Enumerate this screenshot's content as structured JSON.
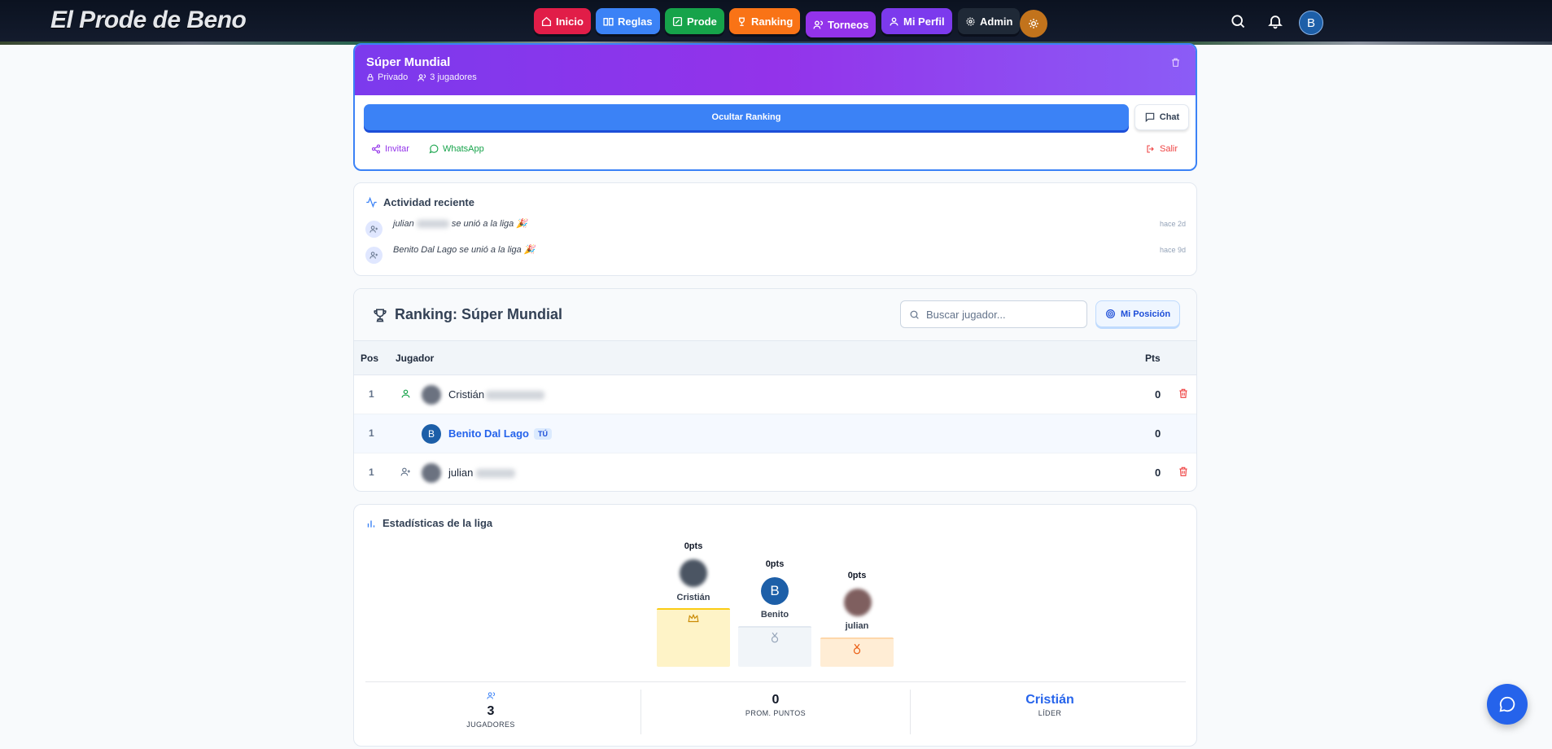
{
  "brand": "El Prode de Beno",
  "nav": [
    {
      "label": "Inicio",
      "icon": "home-icon",
      "color": "#e11d48"
    },
    {
      "label": "Reglas",
      "icon": "book-icon",
      "color": "#3b82f6"
    },
    {
      "label": "Prode",
      "icon": "edit-icon",
      "color": "#16a34a"
    },
    {
      "label": "Ranking",
      "icon": "trophy-icon",
      "color": "#f97316"
    },
    {
      "label": "Torneos",
      "icon": "users-icon",
      "color": "#9333ea"
    },
    {
      "label": "Mi Perfil",
      "icon": "user-icon",
      "color": "#7c3aed"
    },
    {
      "label": "Admin",
      "icon": "gear-icon",
      "color": "#1f2937"
    }
  ],
  "user_initial": "B",
  "league": {
    "title": "Súper Mundial",
    "privacy": "Privado",
    "players": "3 jugadores",
    "hide_ranking": "Ocultar Ranking",
    "chat": "Chat",
    "invite": "Invitar",
    "whatsapp": "WhatsApp",
    "leave": "Salir"
  },
  "activity": {
    "title": "Actividad reciente",
    "items": [
      {
        "name": "julian",
        "text": "se unió a la liga 🎉",
        "time": "hace 2d"
      },
      {
        "name": "Benito Dal Lago",
        "text": "se unió a la liga 🎉",
        "time": "hace 9d"
      }
    ]
  },
  "ranking": {
    "title": "Ranking: Súper Mundial",
    "search_placeholder": "Buscar jugador...",
    "my_position": "Mi Posición",
    "col_pos": "Pos",
    "col_player": "Jugador",
    "col_pts": "Pts",
    "rows": [
      {
        "pos": "1",
        "name": "Cristián",
        "pts": "0"
      },
      {
        "pos": "1",
        "name": "Benito Dal Lago",
        "badge": "TÚ",
        "avatar": "B",
        "pts": "0"
      },
      {
        "pos": "1",
        "name": "julian",
        "pts": "0"
      }
    ]
  },
  "stats": {
    "title": "Estadísticas de la liga",
    "podium": [
      {
        "pts": "0pts",
        "name": "Cristián"
      },
      {
        "pts": "0pts",
        "name": "Benito",
        "avatar": "B"
      },
      {
        "pts": "0pts",
        "name": "julian"
      }
    ],
    "players_value": "3",
    "players_label": "JUGADORES",
    "avg_value": "0",
    "avg_label": "PROM. PUNTOS",
    "leader_value": "Cristián",
    "leader_label": "LÍDER"
  }
}
